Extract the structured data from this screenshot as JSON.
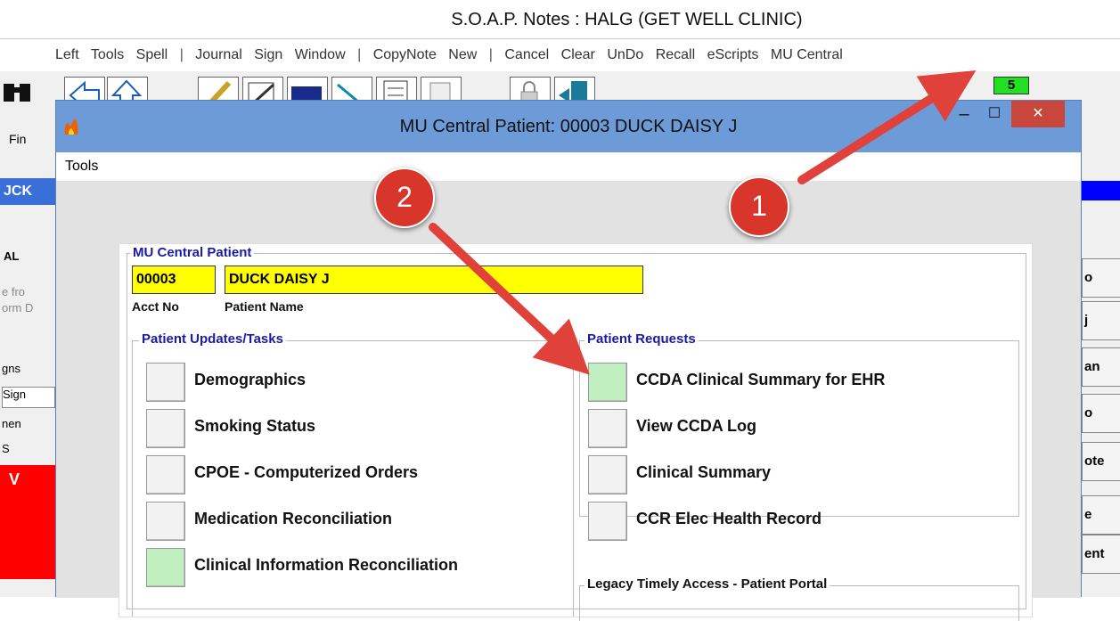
{
  "outer_window": {
    "title": "S.O.A.P. Notes : HALG   (GET WELL CLINIC)",
    "menu": [
      "Left",
      "Tools",
      "Spell",
      "|",
      "Journal",
      "Sign",
      "Window",
      "|",
      "CopyNote",
      "New",
      "|",
      "Cancel",
      "Clear",
      "UnDo",
      "Recall",
      "eScripts",
      "MU Central"
    ],
    "toolbar_count": "5",
    "left_strip": {
      "find": "Fin",
      "ck": "JCK",
      "al": "AL",
      "e_fro": "e fro",
      "orm": "orm D",
      "gns": "gns",
      "sign": "Sign",
      "nen": "nen",
      "s_box": "S",
      "v": "V"
    },
    "right_buttons": [
      "o",
      "j",
      "an",
      "o",
      "ote",
      "e",
      "ent"
    ]
  },
  "dialog": {
    "title": "MU Central Patient: 00003 DUCK DAISY J",
    "menu": [
      "Tools"
    ],
    "controls": {
      "minimize": "–",
      "maximize": "☐",
      "close": "✕"
    },
    "patient_section": {
      "label": "MU Central Patient",
      "acct_no": "00003",
      "patient_name": "DUCK DAISY J",
      "acct_caption": "Acct No",
      "name_caption": "Patient Name"
    },
    "updates_section": {
      "label": "Patient Updates/Tasks",
      "items": [
        {
          "label": "Demographics",
          "state": "normal"
        },
        {
          "label": "Smoking Status",
          "state": "normal"
        },
        {
          "label": "CPOE - Computerized Orders",
          "state": "normal"
        },
        {
          "label": "Medication Reconciliation",
          "state": "normal"
        },
        {
          "label": "Clinical Information Reconciliation",
          "state": "green"
        }
      ]
    },
    "requests_section": {
      "label": "Patient Requests",
      "items": [
        {
          "label": "CCDA Clinical Summary for EHR",
          "state": "green"
        },
        {
          "label": "View CCDA Log",
          "state": "normal"
        },
        {
          "label": "Clinical Summary",
          "state": "normal"
        },
        {
          "label": "CCR Elec Health Record",
          "state": "normal"
        }
      ]
    },
    "legacy_section": {
      "label": "Legacy Timely Access - Patient Portal"
    }
  },
  "annotations": {
    "marker_1": "1",
    "marker_2": "2",
    "arrow_color": "#e0413a"
  }
}
